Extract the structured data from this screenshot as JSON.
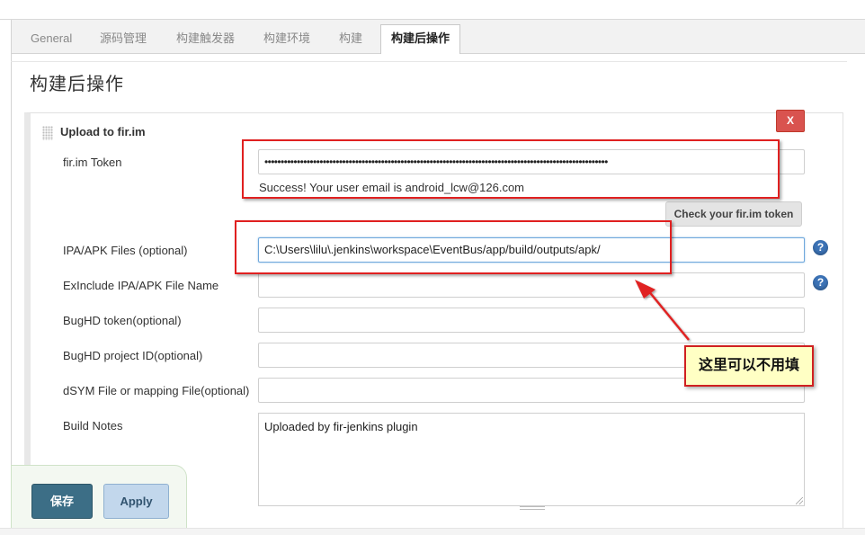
{
  "tabs": [
    {
      "label": "General"
    },
    {
      "label": "源码管理"
    },
    {
      "label": "构建触发器"
    },
    {
      "label": "构建环境"
    },
    {
      "label": "构建"
    },
    {
      "label": "构建后操作"
    }
  ],
  "active_tab": "构建后操作",
  "section_title": "构建后操作",
  "panel": {
    "heading": "Upload to fir.im",
    "delete_label": "X"
  },
  "fields": {
    "token": {
      "label": "fir.im Token",
      "masked_value": "••••••••••••••••••••••••••••••••••••••••••••••••••••••••••••••••••••••••••••••••••••••••••••••••••••••••••"
    },
    "success_message": "Success! Your user email is android_lcw@126.com",
    "check_button": "Check your fir.im token",
    "ipa_apk_files": {
      "label": "IPA/APK Files (optional)",
      "value": "C:\\Users\\lilu\\.jenkins\\workspace\\EventBus/app/build/outputs/apk/"
    },
    "exinclude": {
      "label": "ExInclude IPA/APK File Name",
      "value": ""
    },
    "bughd_token": {
      "label": "BugHD token(optional)",
      "value": ""
    },
    "bughd_project": {
      "label": "BugHD project ID(optional)",
      "value": ""
    },
    "dsym": {
      "label": "dSYM File or mapping File(optional)",
      "value": ""
    },
    "build_notes": {
      "label": "Build Notes",
      "value": "Uploaded by fir-jenkins plugin"
    }
  },
  "help_icon_glyph": "?",
  "annotation": {
    "callout_text": "这里可以不用填",
    "color": "#e02020"
  },
  "buttons": {
    "save": "保存",
    "apply": "Apply"
  },
  "colors": {
    "save_bg": "#3c6e86",
    "apply_bg": "#c2d7ec",
    "delete_bg": "#d9534f",
    "help_bg": "#3c73b6"
  }
}
